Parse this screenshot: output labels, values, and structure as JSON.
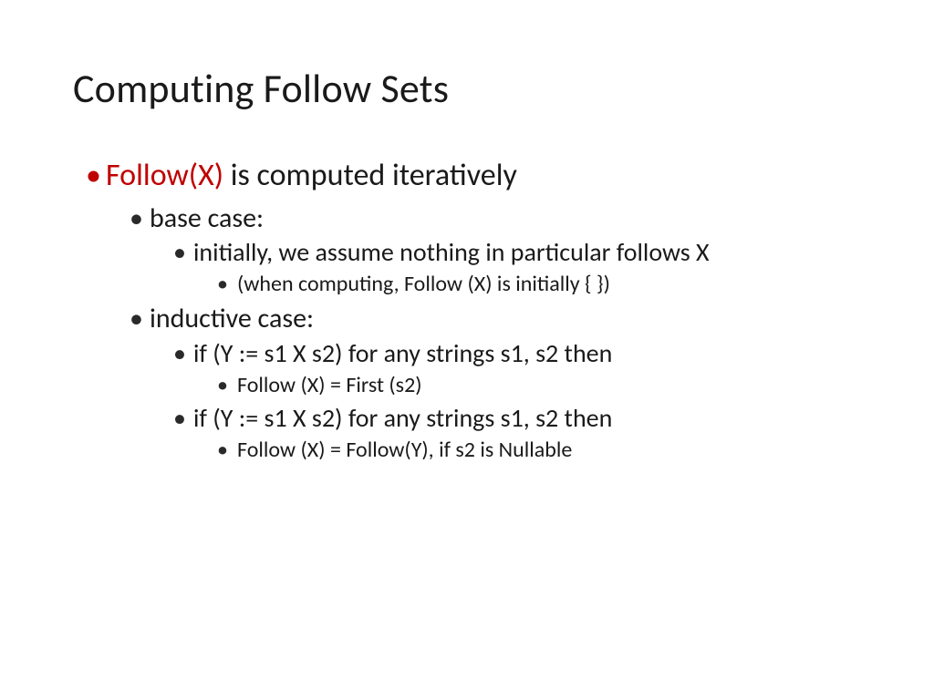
{
  "title": "Computing Follow Sets",
  "main": {
    "highlight": "Follow(X)",
    "rest": " is computed iteratively"
  },
  "base": {
    "label": "base case:",
    "line1": "initially, we assume nothing in particular follows X",
    "line2": "(when computing, Follow (X) is initially { })"
  },
  "inductive": {
    "label": "inductive case:",
    "if1": "if (Y := s1 X s2) for any strings s1, s2 then",
    "rule1": "Follow (X) = First (s2)",
    "if2": "if (Y := s1 X s2) for any strings s1, s2 then",
    "rule2": "Follow (X) = Follow(Y),  if s2 is Nullable"
  }
}
